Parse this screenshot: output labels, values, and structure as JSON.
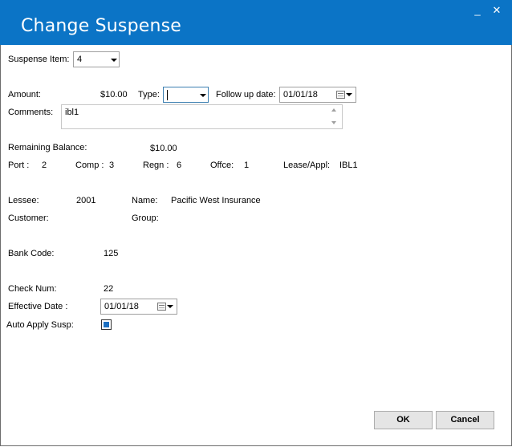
{
  "window": {
    "title": "Change Suspense",
    "minimize_glyph": "_",
    "close_glyph": "✕",
    "titlebar_color": "#0b74c6"
  },
  "suspense_item": {
    "label": "Suspense Item:",
    "value": "4"
  },
  "amount": {
    "label": "Amount:",
    "value": "$10.00"
  },
  "type": {
    "label": "Type:",
    "value": ""
  },
  "follow_up": {
    "label": "Follow up date:",
    "value": "01/01/18"
  },
  "comments": {
    "label": "Comments:",
    "value": "ibl1"
  },
  "remaining_balance": {
    "label": "Remaining Balance:",
    "value": "$10.00"
  },
  "port": {
    "label": "Port :",
    "value": "2"
  },
  "comp": {
    "label": "Comp :",
    "value": "3"
  },
  "regn": {
    "label": "Regn :",
    "value": "6"
  },
  "office": {
    "label": "Offce:",
    "value": "1"
  },
  "lease": {
    "label": "Lease/Appl:",
    "value": "IBL1"
  },
  "lessee": {
    "label": "Lessee:",
    "value": "2001"
  },
  "name": {
    "label": "Name:",
    "value": "Pacific West Insurance"
  },
  "customer": {
    "label": "Customer:",
    "value": ""
  },
  "group": {
    "label": "Group:",
    "value": ""
  },
  "bank_code": {
    "label": "Bank Code:",
    "value": "125"
  },
  "check_num": {
    "label": "Check Num:",
    "value": "22"
  },
  "effective_date": {
    "label": "Effective Date :",
    "value": "01/01/18"
  },
  "auto_apply": {
    "label": "Auto Apply Susp:",
    "checked": true,
    "check_color": "#1c6fc1"
  },
  "buttons": {
    "ok": "OK",
    "cancel": "Cancel"
  }
}
